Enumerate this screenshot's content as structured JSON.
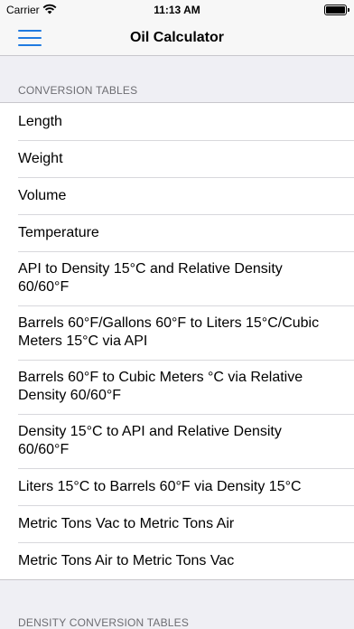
{
  "status_bar": {
    "carrier": "Carrier",
    "time": "11:13 AM"
  },
  "nav": {
    "title": "Oil Calculator"
  },
  "accent_color": "#1f7ae0",
  "sections": [
    {
      "header": "CONVERSION TABLES",
      "items": [
        "Length",
        "Weight",
        "Volume",
        "Temperature",
        "API to Density 15°C and Relative Density 60/60°F",
        "Barrels 60°F/Gallons 60°F to Liters 15°C/Cubic Meters 15°C via API",
        "Barrels 60°F to Cubic Meters °C via Relative Density 60/60°F",
        "Density 15°C to API and Relative Density 60/60°F",
        "Liters 15°C to Barrels 60°F via Density 15°C",
        "Metric Tons Vac to Metric Tons Air",
        "Metric Tons Air to Metric Tons Vac"
      ]
    },
    {
      "header": "DENSITY CONVERSION TABLES",
      "items": []
    }
  ]
}
